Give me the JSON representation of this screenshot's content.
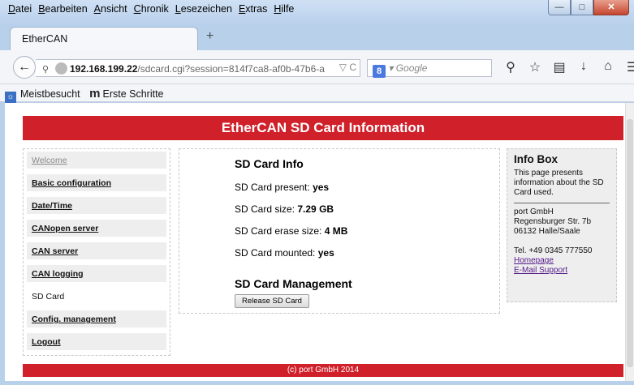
{
  "browser": {
    "menu": [
      "Datei",
      "Bearbeiten",
      "Ansicht",
      "Chronik",
      "Lesezeichen",
      "Extras",
      "Hilfe"
    ],
    "tab_title": "EtherCAN",
    "url_host": "192.168.199.22",
    "url_path": "/sdcard.cgi?session=814f7ca8-af0b-47b6-a",
    "search_placeholder": "Google",
    "bookmarks": [
      "Meistbesucht",
      "Erste Schritte"
    ]
  },
  "page": {
    "title": "EtherCAN SD Card Information",
    "nav": [
      "Welcome",
      "Basic configuration",
      "Date/Time",
      "CANopen server",
      "CAN server",
      "CAN logging",
      "SD Card",
      "Config. management",
      "Logout"
    ],
    "main": {
      "heading": "SD Card Info",
      "present_label": "SD Card present:",
      "present_value": "yes",
      "size_label": "SD Card size:",
      "size_value": "7.29 GB",
      "erase_label": "SD Card erase size:",
      "erase_value": "4 MB",
      "mounted_label": "SD Card mounted:",
      "mounted_value": "yes",
      "mgmt_heading": "SD Card Management",
      "release_button": "Release SD Card"
    },
    "info_box": {
      "title": "Info Box",
      "description": "This page presents information about the SD Card used.",
      "company": "port GmbH",
      "street": "Regensburger Str. 7b",
      "city": "06132 Halle/Saale",
      "tel": "Tel. +49 0345 777550",
      "homepage": "Homepage",
      "email": "E-Mail Support"
    },
    "footer": "(c) port GmbH 2014"
  }
}
